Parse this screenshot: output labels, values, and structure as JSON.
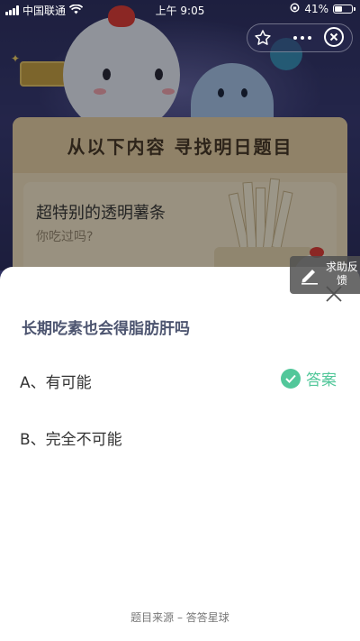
{
  "status_bar": {
    "carrier": "中国联通",
    "time": "上午 9:05",
    "battery": "41%",
    "battery_level": 0.41
  },
  "scene": {
    "card_title": "从以下内容 寻找明日题目",
    "topic_title": "超特别的透明薯条",
    "topic_subtitle": "你吃过吗?"
  },
  "help_button": {
    "label": "求助反馈"
  },
  "quiz": {
    "question": "长期吃素也会得脂肪肝吗",
    "options": [
      {
        "text": "A、有可能"
      },
      {
        "text": "B、完全不可能"
      }
    ],
    "answer_label": "答案",
    "source": "题目来源 – 答答星球"
  },
  "colors": {
    "accent_green": "#52c79a",
    "question_text": "#4d5570",
    "scene_bg": "#2f3162"
  }
}
